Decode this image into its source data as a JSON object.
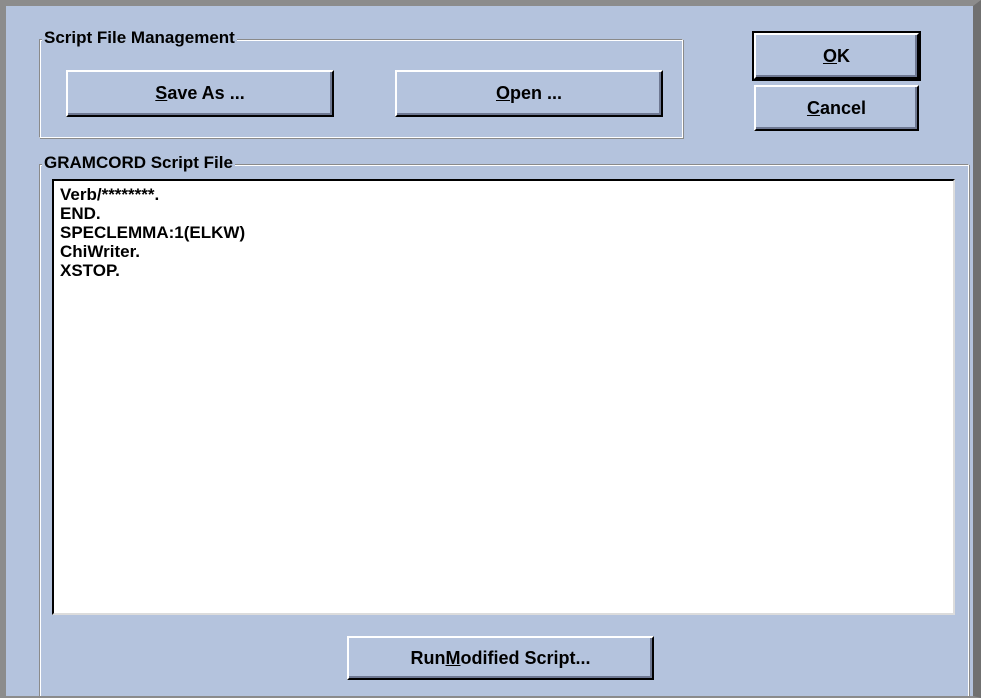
{
  "script_management": {
    "label": "Script File Management",
    "save_as": {
      "pre": "",
      "hot": "S",
      "post": "ave As ..."
    },
    "open": {
      "pre": "",
      "hot": "O",
      "post": "pen ..."
    }
  },
  "ok": {
    "pre": "",
    "hot": "O",
    "post": "K"
  },
  "cancel": {
    "pre": "",
    "hot": "C",
    "post": "ancel"
  },
  "script_file": {
    "label": "GRAMCORD Script File",
    "lines": [
      "Verb/********.",
      "END.",
      "SPECLEMMA:1(ELKW)",
      "ChiWriter.",
      "XSTOP."
    ]
  },
  "run": {
    "pre": "Run ",
    "hot": "M",
    "post": "odified Script..."
  }
}
